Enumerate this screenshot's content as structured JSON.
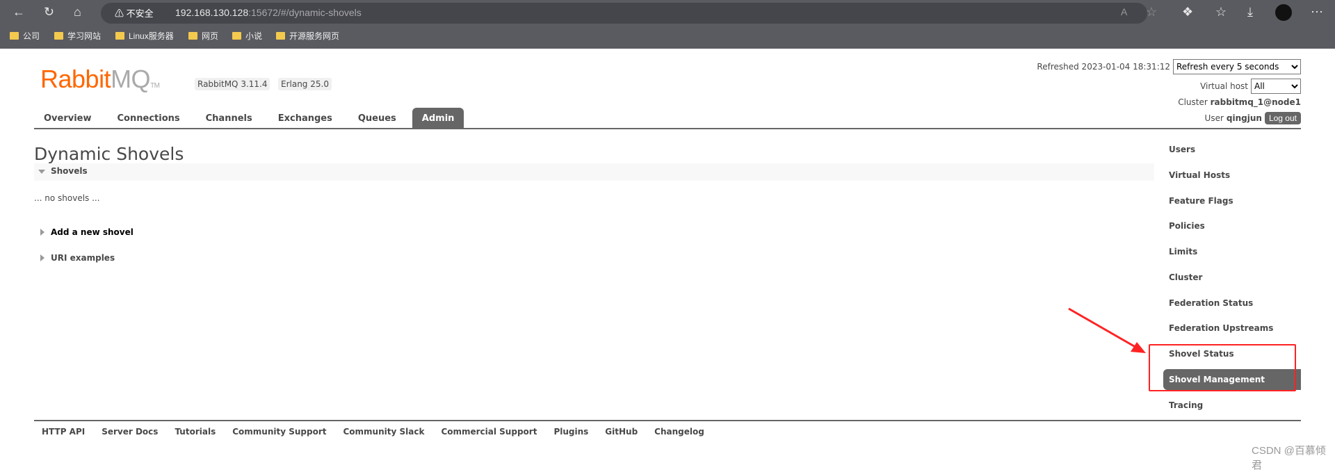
{
  "browser": {
    "security_label": "不安全",
    "url_host": "192.168.130.128",
    "url_rest": ":15672/#/dynamic-shovels",
    "bookmarks": [
      "公司",
      "学习网站",
      "Linux服务器",
      "网页",
      "小说",
      "开源服务网页"
    ]
  },
  "header": {
    "logo": {
      "rabbit": "Rabbit",
      "mq": "MQ",
      "tm": "TM"
    },
    "version_badge": "RabbitMQ 3.11.4",
    "erlang_badge": "Erlang 25.0",
    "refreshed_label": "Refreshed 2023-01-04 18:31:12",
    "refresh_select": "Refresh every 5 seconds",
    "vhost_label": "Virtual host",
    "vhost_select": "All",
    "cluster_label": "Cluster",
    "cluster_name": "rabbitmq_1@node1",
    "user_label": "User",
    "user_name": "qingjun",
    "logout": "Log out"
  },
  "nav": {
    "tabs": [
      "Overview",
      "Connections",
      "Channels",
      "Exchanges",
      "Queues",
      "Admin"
    ],
    "active": "Admin"
  },
  "main": {
    "title": "Dynamic Shovels",
    "section": "Shovels",
    "empty": "... no shovels ...",
    "add_shovel": "Add a new shovel",
    "uri_examples": "URI examples"
  },
  "admin_menu": {
    "items": [
      "Users",
      "Virtual Hosts",
      "Feature Flags",
      "Policies",
      "Limits",
      "Cluster",
      "Federation Status",
      "Federation Upstreams",
      "Shovel Status",
      "Shovel Management",
      "Tracing"
    ],
    "selected": "Shovel Management"
  },
  "footer": {
    "links": [
      "HTTP API",
      "Server Docs",
      "Tutorials",
      "Community Support",
      "Community Slack",
      "Commercial Support",
      "Plugins",
      "GitHub",
      "Changelog"
    ]
  },
  "watermark": "CSDN @百慕倾君",
  "colors": {
    "brand": "#ff6600",
    "active_tab": "#666666",
    "annotation": "#ff2222"
  }
}
